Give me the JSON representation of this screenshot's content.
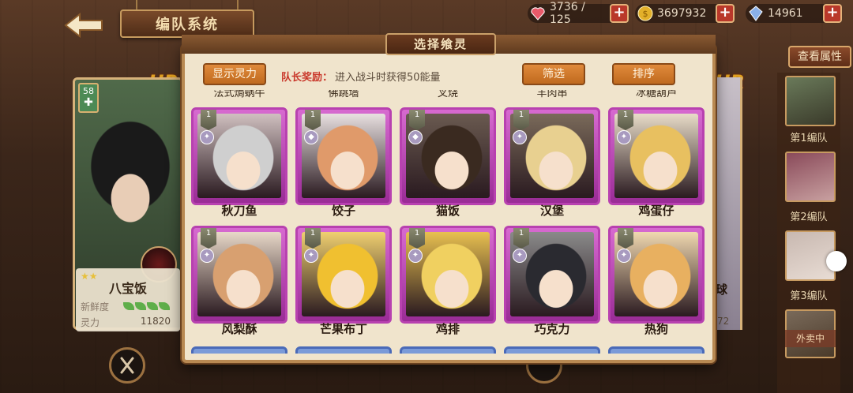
{
  "header": {
    "title": "编队系统"
  },
  "resources": {
    "stamina": "3736 / 125",
    "gold": "3697932",
    "gems": "14961"
  },
  "left_character": {
    "rarity": "UR",
    "level": "58",
    "name": "八宝饭",
    "stars": "★★",
    "freshness_label": "新鲜度",
    "power_label": "灵力",
    "power_value": "11820"
  },
  "right_character": {
    "rarity": "UR",
    "name_partial": "球",
    "power_partial": "72"
  },
  "side_panel": {
    "view_attributes": "查看属性",
    "teams": [
      {
        "label": "第1编队"
      },
      {
        "label": "第2编队"
      },
      {
        "label": "第3编队"
      }
    ],
    "sold_tag": "外卖中"
  },
  "modal": {
    "title": "选择飨灵",
    "show_power_button": "显示灵力",
    "filter_button": "筛选",
    "sort_button": "排序",
    "leader_bonus_label": "队长奖励：",
    "leader_bonus_text": "进入战斗时获得50能量",
    "peek_names": [
      "法式焗蜗牛",
      "佛跳墙",
      "叉烧",
      "羊肉串",
      "冰糖葫芦"
    ],
    "cards": [
      {
        "name": "秋刀鱼",
        "level": "1",
        "element": "✦",
        "hair": "#cfcfcf",
        "bg": "#d0c0c0"
      },
      {
        "name": "饺子",
        "level": "1",
        "element": "◆",
        "hair": "#e09a6a",
        "bg": "#e8e0e0"
      },
      {
        "name": "猫饭",
        "level": "1",
        "element": "◆",
        "hair": "#3a2a20",
        "bg": "#6a5a50"
      },
      {
        "name": "汉堡",
        "level": "1",
        "element": "✦",
        "hair": "#e8d090",
        "bg": "#7a6a5a"
      },
      {
        "name": "鸡蛋仔",
        "level": "1",
        "element": "✦",
        "hair": "#e8c060",
        "bg": "#e8dcc8"
      },
      {
        "name": "风梨酥",
        "level": "1",
        "element": "✦",
        "hair": "#d8a070",
        "bg": "#e8d8c8"
      },
      {
        "name": "芒果布丁",
        "level": "1",
        "element": "✦",
        "hair": "#f0c030",
        "bg": "#f0d070"
      },
      {
        "name": "鸡排",
        "level": "1",
        "element": "✦",
        "hair": "#f0d060",
        "bg": "#e8c050"
      },
      {
        "name": "巧克力",
        "level": "1",
        "element": "✦",
        "hair": "#2a2a30",
        "bg": "#8a8a8a"
      },
      {
        "name": "热狗",
        "level": "1",
        "element": "✦",
        "hair": "#e8b060",
        "bg": "#f0d8b0"
      }
    ]
  },
  "colors": {
    "card_border": "#b841b0",
    "button_orange": "#d97a2e",
    "leader_red": "#c9372a"
  }
}
